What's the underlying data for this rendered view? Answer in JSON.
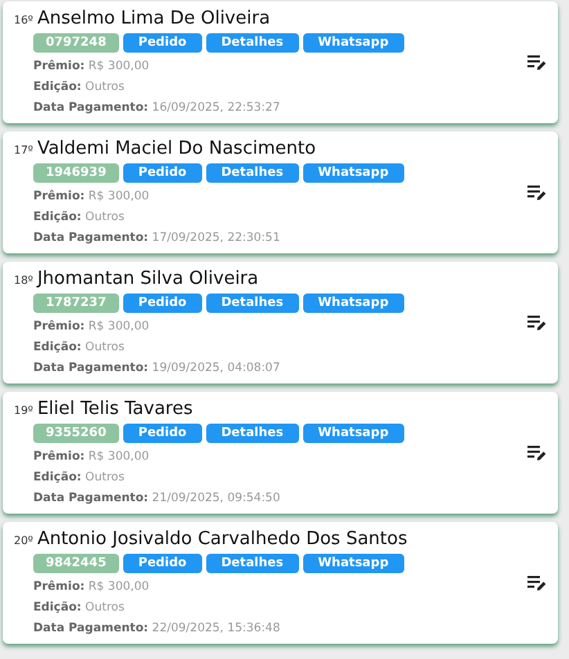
{
  "winners": [
    {
      "rank": "16º",
      "name": "Anselmo Lima De Oliveira",
      "code": "0797248",
      "buttons": [
        "Pedido",
        "Detalhes",
        "Whatsapp"
      ],
      "fields": [
        {
          "label": "Prêmio:",
          "value": "R$ 300,00"
        },
        {
          "label": "Edição:",
          "value": "Outros"
        },
        {
          "label": "Data Pagamento:",
          "value": "16/09/2025, 22:53:27"
        }
      ]
    },
    {
      "rank": "17º",
      "name": "Valdemi Maciel Do Nascimento",
      "code": "1946939",
      "buttons": [
        "Pedido",
        "Detalhes",
        "Whatsapp"
      ],
      "fields": [
        {
          "label": "Prêmio:",
          "value": "R$ 300,00"
        },
        {
          "label": "Edição:",
          "value": "Outros"
        },
        {
          "label": "Data Pagamento:",
          "value": "17/09/2025, 22:30:51"
        }
      ]
    },
    {
      "rank": "18º",
      "name": "Jhomantan Silva Oliveira",
      "code": "1787237",
      "buttons": [
        "Pedido",
        "Detalhes",
        "Whatsapp"
      ],
      "fields": [
        {
          "label": "Prêmio:",
          "value": "R$ 300,00"
        },
        {
          "label": "Edição:",
          "value": "Outros"
        },
        {
          "label": "Data Pagamento:",
          "value": "19/09/2025, 04:08:07"
        }
      ]
    },
    {
      "rank": "19º",
      "name": "Eliel Telis Tavares",
      "code": "9355260",
      "buttons": [
        "Pedido",
        "Detalhes",
        "Whatsapp"
      ],
      "fields": [
        {
          "label": "Prêmio:",
          "value": "R$ 300,00"
        },
        {
          "label": "Edição:",
          "value": "Outros"
        },
        {
          "label": "Data Pagamento:",
          "value": "21/09/2025, 09:54:50"
        }
      ]
    },
    {
      "rank": "20º",
      "name": "Antonio Josivaldo Carvalhedo Dos Santos",
      "code": "9842445",
      "buttons": [
        "Pedido",
        "Detalhes",
        "Whatsapp"
      ],
      "fields": [
        {
          "label": "Prêmio:",
          "value": "R$ 300,00"
        },
        {
          "label": "Edição:",
          "value": "Outros"
        },
        {
          "label": "Data Pagamento:",
          "value": "22/09/2025, 15:36:48"
        }
      ]
    }
  ]
}
